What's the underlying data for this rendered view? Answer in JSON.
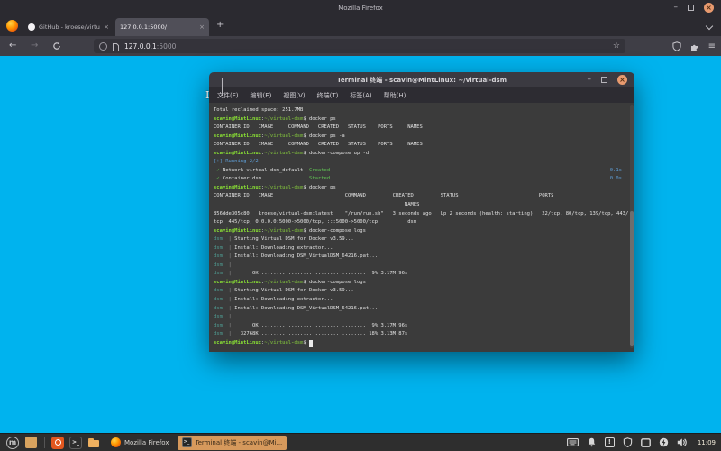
{
  "firefox": {
    "title": "Mozilla Firefox",
    "tabs": [
      {
        "label": "GitHub - kroese/virtual-dsm",
        "active": false
      },
      {
        "label": "127.0.0.1:5000/",
        "active": true
      }
    ],
    "url": {
      "host": "127.0.0.1",
      "port": ":5000"
    }
  },
  "terminal": {
    "title": "Terminal 终端 - scavin@MintLinux: ~/virtual-dsm",
    "menu": [
      "文件(F)",
      "编辑(E)",
      "视图(V)",
      "终端(T)",
      "标签(A)",
      "帮助(H)"
    ],
    "lines": [
      [
        {
          "t": "Total reclaimed space: 251.7MB",
          "c": "w"
        }
      ],
      [
        {
          "t": "scavin@MintLinux",
          "c": "g"
        },
        {
          "t": ":",
          "c": "w"
        },
        {
          "t": "~/virtual-dsm",
          "c": "p"
        },
        {
          "t": "$ ",
          "c": "w"
        },
        {
          "t": "docker ps",
          "c": "w"
        }
      ],
      [
        {
          "t": "CONTAINER ID   IMAGE     COMMAND   CREATED   STATUS    PORTS     NAMES",
          "c": "w"
        }
      ],
      [
        {
          "t": "scavin@MintLinux",
          "c": "g"
        },
        {
          "t": ":",
          "c": "w"
        },
        {
          "t": "~/virtual-dsm",
          "c": "p"
        },
        {
          "t": "$ ",
          "c": "w"
        },
        {
          "t": "docker ps -a",
          "c": "w"
        }
      ],
      [
        {
          "t": "CONTAINER ID   IMAGE     COMMAND   CREATED   STATUS    PORTS     NAMES",
          "c": "w"
        }
      ],
      [
        {
          "t": "scavin@MintLinux",
          "c": "g"
        },
        {
          "t": ":",
          "c": "w"
        },
        {
          "t": "~/virtual-dsm",
          "c": "p"
        },
        {
          "t": "$ ",
          "c": "w"
        },
        {
          "t": "docker-compose up -d",
          "c": "w"
        }
      ],
      [
        {
          "t": "[+] Running 2/2",
          "c": "b"
        }
      ],
      [
        {
          "t": " ✓",
          "c": "gr"
        },
        {
          "t": " Network virtual-dsm_default  ",
          "c": "w"
        },
        {
          "t": "Created",
          "c": "gr"
        },
        {
          "t": "0.1s",
          "c": "b fr"
        }
      ],
      [
        {
          "t": " ✓",
          "c": "gr"
        },
        {
          "t": " Container dsm                ",
          "c": "w"
        },
        {
          "t": "Started",
          "c": "gr"
        },
        {
          "t": "0.0s",
          "c": "b fr"
        }
      ],
      [
        {
          "t": "scavin@MintLinux",
          "c": "g"
        },
        {
          "t": ":",
          "c": "w"
        },
        {
          "t": "~/virtual-dsm",
          "c": "p"
        },
        {
          "t": "$ ",
          "c": "w"
        },
        {
          "t": "docker ps",
          "c": "w"
        }
      ],
      [
        {
          "t": "CONTAINER ID   IMAGE                        COMMAND         CREATED         STATUS                           PORTS",
          "c": "w"
        }
      ],
      [
        {
          "t": "                                                                NAMES",
          "c": "w"
        }
      ],
      [
        {
          "t": "856dde305c80   kroese/virtual-dsm:latest    \"/run/run.sh\"   3 seconds ago   Up 2 seconds (health: starting)   22/tcp, 80/tcp, 139/tcp, 443/",
          "c": "w"
        }
      ],
      [
        {
          "t": "tcp, 445/tcp, 0.0.0.0:5000->5000/tcp, :::5000->5000/tcp          dsm",
          "c": "w"
        }
      ],
      [
        {
          "t": "scavin@MintLinux",
          "c": "g"
        },
        {
          "t": ":",
          "c": "w"
        },
        {
          "t": "~/virtual-dsm",
          "c": "p"
        },
        {
          "t": "$ ",
          "c": "w"
        },
        {
          "t": "docker-compose logs",
          "c": "w"
        }
      ],
      [
        {
          "t": "dsm",
          "c": "t"
        },
        {
          "t": "  |",
          "c": "d"
        },
        {
          "t": " Starting Virtual DSM for Docker v3.59...",
          "c": "w"
        }
      ],
      [
        {
          "t": "dsm",
          "c": "t"
        },
        {
          "t": "  |",
          "c": "d"
        },
        {
          "t": " Install: Downloading extractor...",
          "c": "w"
        }
      ],
      [
        {
          "t": "dsm",
          "c": "t"
        },
        {
          "t": "  |",
          "c": "d"
        },
        {
          "t": " Install: Downloading DSM_VirtualDSM_64216.pat...",
          "c": "w"
        }
      ],
      [
        {
          "t": "dsm",
          "c": "t"
        },
        {
          "t": "  |",
          "c": "d"
        }
      ],
      [
        {
          "t": "dsm",
          "c": "t"
        },
        {
          "t": "  |",
          "c": "d"
        },
        {
          "t": "       OK ........ ........ ........ ........  9% 3.17M 96s",
          "c": "w"
        }
      ],
      [
        {
          "t": "scavin@MintLinux",
          "c": "g"
        },
        {
          "t": ":",
          "c": "w"
        },
        {
          "t": "~/virtual-dsm",
          "c": "p"
        },
        {
          "t": "$ ",
          "c": "w"
        },
        {
          "t": "docker-compose logs",
          "c": "w"
        }
      ],
      [
        {
          "t": "dsm",
          "c": "t"
        },
        {
          "t": "  |",
          "c": "d"
        },
        {
          "t": " Starting Virtual DSM for Docker v3.59...",
          "c": "w"
        }
      ],
      [
        {
          "t": "dsm",
          "c": "t"
        },
        {
          "t": "  |",
          "c": "d"
        },
        {
          "t": " Install: Downloading extractor...",
          "c": "w"
        }
      ],
      [
        {
          "t": "dsm",
          "c": "t"
        },
        {
          "t": "  |",
          "c": "d"
        },
        {
          "t": " Install: Downloading DSM_VirtualDSM_64216.pat...",
          "c": "w"
        }
      ],
      [
        {
          "t": "dsm",
          "c": "t"
        },
        {
          "t": "  |",
          "c": "d"
        }
      ],
      [
        {
          "t": "dsm",
          "c": "t"
        },
        {
          "t": "  |",
          "c": "d"
        },
        {
          "t": "       OK ........ ........ ........ ........  9% 3.17M 96s",
          "c": "w"
        }
      ],
      [
        {
          "t": "dsm",
          "c": "t"
        },
        {
          "t": "  |",
          "c": "d"
        },
        {
          "t": "   32768K ........ ........ ........ ........ 18% 3.13M 87s",
          "c": "w"
        }
      ],
      [
        {
          "t": "scavin@MintLinux",
          "c": "g"
        },
        {
          "t": ":",
          "c": "w"
        },
        {
          "t": "~/virtual-dsm",
          "c": "p"
        },
        {
          "t": "$ ",
          "c": "w"
        },
        {
          "t": " ",
          "c": "cursor"
        }
      ]
    ]
  },
  "taskbar": {
    "window_buttons": [
      {
        "label": "Mozilla Firefox",
        "icon": "firefox",
        "active": false
      },
      {
        "label": "Terminal 终端 - scavin@Mi...",
        "icon": "terminal",
        "active": true
      }
    ],
    "clock": "11:09"
  },
  "glyphs": {
    "back": "←",
    "forward": "→",
    "star": "☆",
    "plus": "+",
    "close": "×",
    "menu": "≡",
    "minimize": "–",
    "prompt": ">_",
    "mint": "m",
    "update": "!"
  },
  "colors": {
    "desktop": "#00b3ee",
    "accent_orange": "#d6995c",
    "prompt_green": "#8ae234",
    "compose_blue": "#5f9fd8",
    "ok_green": "#61c554",
    "terminal_bg": "#3b3b3b"
  }
}
